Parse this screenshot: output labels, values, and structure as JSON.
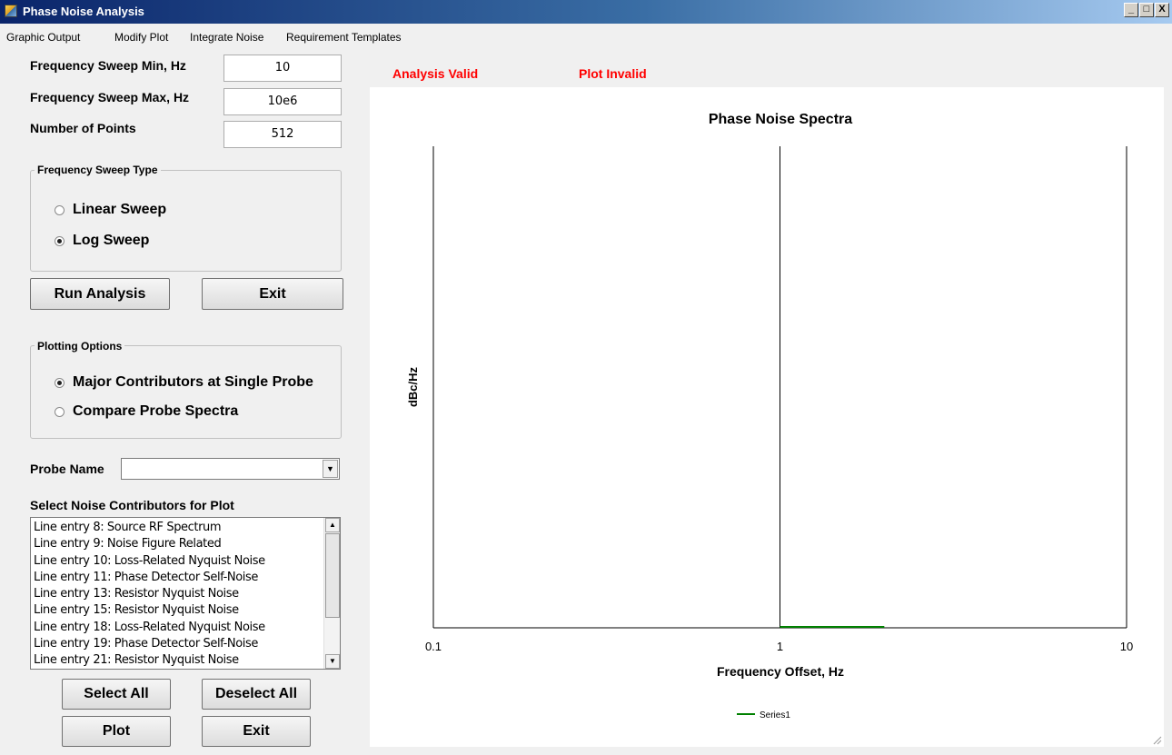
{
  "window": {
    "title": "Phase Noise Analysis",
    "controls": [
      "_",
      "□",
      "X"
    ]
  },
  "menu": [
    "Graphic Output",
    "Modify Plot",
    "Integrate Noise",
    "Requirement Templates"
  ],
  "inputs": {
    "sweep_min_label": "Frequency Sweep Min, Hz",
    "sweep_min_value": "10",
    "sweep_max_label": "Frequency Sweep Max, Hz",
    "sweep_max_value": "10e6",
    "points_label": "Number of Points",
    "points_value": "512"
  },
  "sweep_type": {
    "title": "Frequency Sweep Type",
    "options": [
      "Linear Sweep",
      "Log Sweep"
    ],
    "selected": "Log Sweep"
  },
  "buttons": {
    "run_analysis": "Run Analysis",
    "exit_top": "Exit",
    "select_all": "Select All",
    "deselect_all": "Deselect All",
    "plot": "Plot",
    "exit_bottom": "Exit"
  },
  "plotting_options": {
    "title": "Plotting Options",
    "options": [
      "Major Contributors at Single Probe",
      "Compare Probe Spectra"
    ],
    "selected": "Major Contributors at Single Probe"
  },
  "probe": {
    "label": "Probe Name",
    "value": ""
  },
  "contributors": {
    "label": "Select Noise Contributors for Plot",
    "items": [
      "Line entry 8: Source RF Spectrum",
      "Line entry 9: Noise Figure Related",
      "Line entry 10: Loss-Related Nyquist Noise",
      "Line entry 11: Phase Detector Self-Noise",
      "Line entry 13: Resistor Nyquist Noise",
      "Line entry 15: Resistor Nyquist Noise",
      "Line entry 18: Loss-Related Nyquist Noise",
      "Line entry 19: Phase Detector Self-Noise",
      "Line entry 21: Resistor Nyquist Noise"
    ]
  },
  "status": {
    "analysis": "Analysis Valid",
    "plot": "Plot Invalid",
    "color": "#ff0000"
  },
  "chart_data": {
    "type": "line",
    "title": "Phase Noise Spectra",
    "xlabel": "Frequency Offset, Hz",
    "ylabel": "dBc/Hz",
    "x_scale": "log",
    "xlim": [
      0.1,
      10
    ],
    "x_ticks": [
      "0.1",
      "1",
      "10"
    ],
    "grid": "vertical lines at decades",
    "legend_position": "bottom-center",
    "series": [
      {
        "name": "Series1",
        "color": "#008000",
        "x": [
          1,
          2
        ],
        "y": [
          0,
          0
        ]
      }
    ]
  }
}
